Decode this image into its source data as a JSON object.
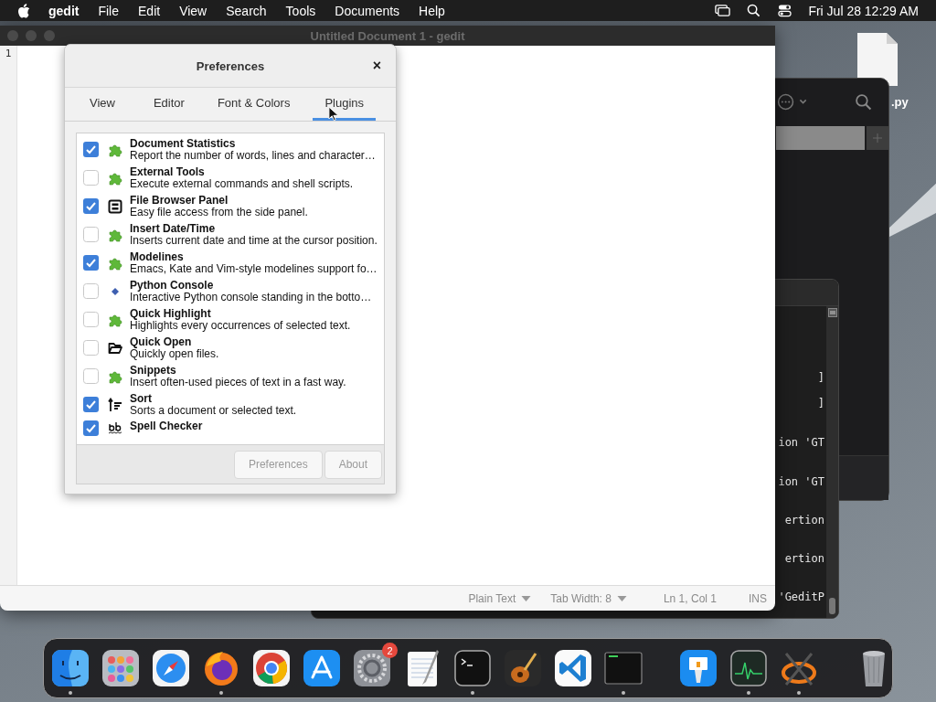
{
  "menu_bar": {
    "app_name": "gedit",
    "items": [
      "File",
      "Edit",
      "View",
      "Search",
      "Tools",
      "Documents",
      "Help"
    ],
    "clock": "Fri Jul 28  12:29 AM"
  },
  "desktop_file": {
    "label": ".py"
  },
  "terminal": {
    "lines": [
      "]",
      "]",
      "ion 'GT",
      "ion 'GT",
      "ertion",
      "ertion",
      "'GeditP"
    ]
  },
  "gedit_window": {
    "title": "Untitled Document 1 - gedit",
    "line_number": "1",
    "status_bar": {
      "language": "Plain Text",
      "tab_width": "Tab Width: 8",
      "position": "Ln 1, Col 1",
      "mode": "INS"
    }
  },
  "preferences_dialog": {
    "title": "Preferences",
    "close": "×",
    "tabs": [
      {
        "label": "View",
        "selected": false
      },
      {
        "label": "Editor",
        "selected": false
      },
      {
        "label": "Font & Colors",
        "selected": false
      },
      {
        "label": "Plugins",
        "selected": true
      }
    ],
    "plugins": [
      {
        "name": "Document Statistics",
        "description": "Report the number of words, lines and character…",
        "checked": true,
        "kind": "puzzle"
      },
      {
        "name": "External Tools",
        "description": "Execute external commands and shell scripts.",
        "checked": false,
        "kind": "puzzle"
      },
      {
        "name": "File Browser Panel",
        "description": "Easy file access from the side panel.",
        "checked": true,
        "kind": "panel"
      },
      {
        "name": "Insert Date/Time",
        "description": "Inserts current date and time at the cursor position.",
        "checked": false,
        "kind": "puzzle"
      },
      {
        "name": "Modelines",
        "description": "Emacs, Kate and Vim-style modelines support fo…",
        "checked": true,
        "kind": "puzzle"
      },
      {
        "name": "Python Console",
        "description": "Interactive Python console standing in the botto…",
        "checked": false,
        "kind": "python"
      },
      {
        "name": "Quick Highlight",
        "description": "Highlights every occurrences of selected text.",
        "checked": false,
        "kind": "puzzle"
      },
      {
        "name": "Quick Open",
        "description": "Quickly open files.",
        "checked": false,
        "kind": "folder"
      },
      {
        "name": "Snippets",
        "description": "Insert often-used pieces of text in a fast way.",
        "checked": false,
        "kind": "puzzle"
      },
      {
        "name": "Sort",
        "description": "Sorts a document or selected text.",
        "checked": true,
        "kind": "sort"
      },
      {
        "name": "Spell Checker",
        "checked": true,
        "kind": "spell"
      }
    ],
    "buttons": [
      {
        "label": "Preferences",
        "disabled": true
      },
      {
        "label": "About",
        "disabled": true
      }
    ]
  },
  "dock": {
    "apps": [
      {
        "kind": "finder",
        "running": true
      },
      {
        "kind": "launchpad",
        "running": false
      },
      {
        "kind": "safari",
        "running": false
      },
      {
        "kind": "firefox",
        "running": true
      },
      {
        "kind": "chrome",
        "running": false
      },
      {
        "kind": "appstore",
        "running": false
      },
      {
        "kind": "settings",
        "running": false,
        "badge": "2"
      },
      {
        "kind": "textedit",
        "running": false
      },
      {
        "kind": "terminal",
        "running": true
      },
      {
        "kind": "garageband",
        "running": false
      },
      {
        "kind": "vscode",
        "running": false
      },
      {
        "kind": "console",
        "running": true
      }
    ],
    "recent": [
      {
        "kind": "keynote",
        "running": false
      },
      {
        "kind": "activity",
        "running": true
      },
      {
        "kind": "xquartz",
        "running": true
      }
    ],
    "trash": {
      "kind": "trash",
      "running": false
    }
  }
}
